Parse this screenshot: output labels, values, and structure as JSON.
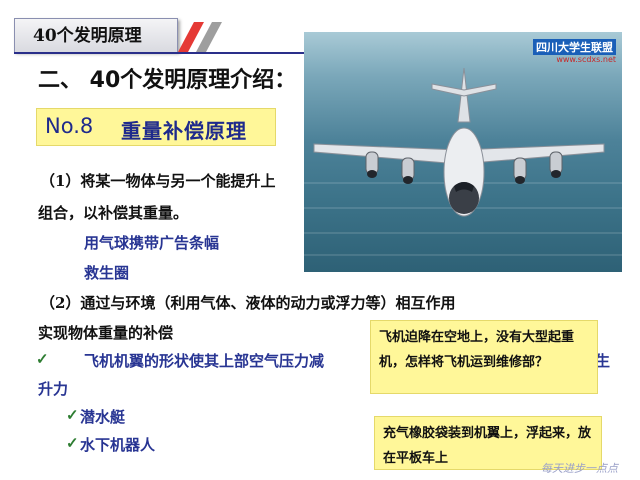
{
  "header": {
    "tab_label": "40个发明原理"
  },
  "section_title": "二、 40个发明原理介绍：",
  "principle": {
    "number": "No.8",
    "name": "重量补偿原理"
  },
  "body": {
    "line1a": "（1）将某一物体与另一个能提升上",
    "line1b": "组合，以补偿其重量。",
    "example1": "用气球携带广告条幅",
    "example2": "救生圈",
    "line2a": "（2）通过与环境（利用气体、液体的动力或浮力等）相互作用",
    "line2b": "实现物体重量的补偿",
    "check_mark": "✓",
    "example3a": "飞机机翼的形状使其上部空气压力减",
    "example3a_tail": "生",
    "example3b": "升力",
    "example4": "潜水艇",
    "example5": "水下机器人"
  },
  "photo": {
    "logo_text": "四川大学生联盟",
    "logo_url": "www.scdxs.net",
    "icon": "airplane-photo"
  },
  "callouts": {
    "question": "飞机迫降在空地上，没有大型起重机，怎样将飞机运到维修部？",
    "answer": "充气橡胶袋装到机翼上，浮起来，放在平板车上"
  },
  "footer_note": "每天进步一点点"
}
